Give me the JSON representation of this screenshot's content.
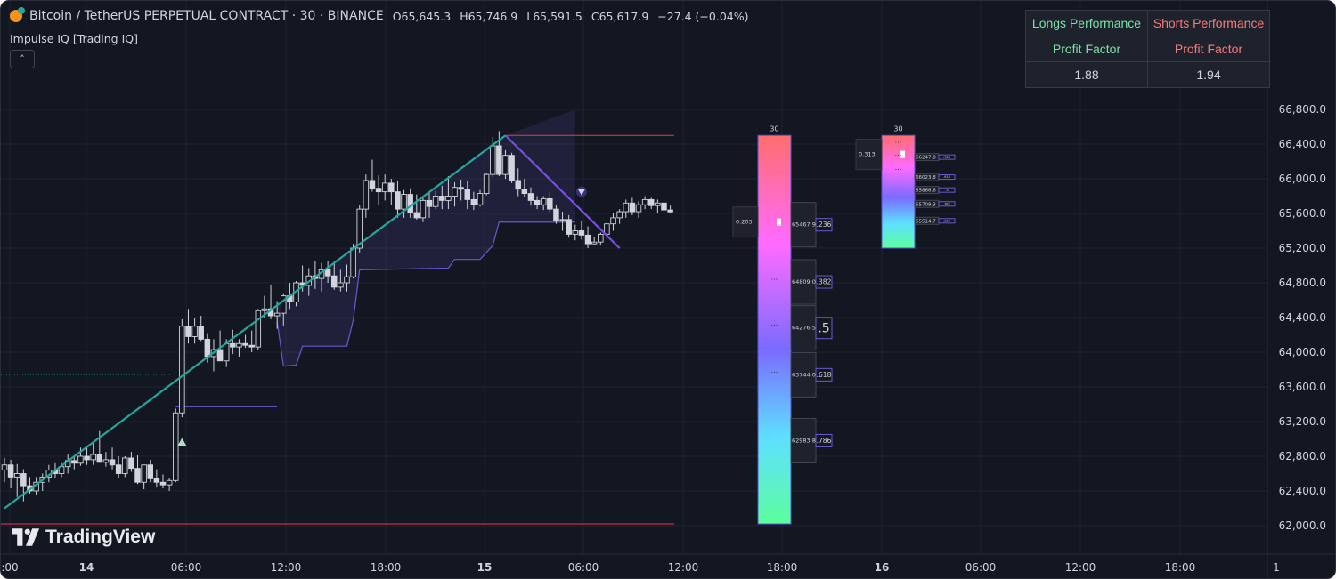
{
  "header": {
    "symbol": "Bitcoin / TetherUS PERPETUAL CONTRACT · 30 · BINANCE",
    "open": "O65,645.3",
    "high": "H65,746.9",
    "low": "L65,591.5",
    "close": "C65,617.9",
    "change": "−27.4 (−0.04%)"
  },
  "indicator": {
    "name": "Impulse IQ [Trading IQ]",
    "collapse_icon": "chevron-up-icon"
  },
  "performance": {
    "longs_header": "Longs Performance",
    "shorts_header": "Shorts Performance",
    "longs_metric": "Profit Factor",
    "shorts_metric": "Profit Factor",
    "longs_value": "1.88",
    "shorts_value": "1.94"
  },
  "branding": {
    "logo_text": "TradingView",
    "logo_icon": "tradingview-logo-icon"
  },
  "colors": {
    "background": "#131722",
    "grid": "#1f2330",
    "text": "#d1d4dc",
    "up_trend": "#26a69a",
    "down_trend": "#7b4fe0",
    "level_red": "#f23645",
    "zone_fill": "#6a5acd",
    "long_header": "#7ee0a6",
    "short_header": "#f77b7b"
  },
  "chart_data": {
    "type": "candlestick",
    "timeframe": "30",
    "ylim": [
      61900,
      66900
    ],
    "y_ticks": [
      "66,800.0",
      "66,400.0",
      "66,000.0",
      "65,600.0",
      "65,200.0",
      "64,800.0",
      "64,400.0",
      "64,000.0",
      "63,600.0",
      "63,200.0",
      "62,800.0",
      "62,400.0",
      "62,000.0"
    ],
    "x_ticks": [
      ":00",
      "14",
      "06:00",
      "12:00",
      "18:00",
      "15",
      "06:00",
      "12:00",
      "18:00",
      "16",
      "06:00",
      "12:00",
      "18:00",
      "1"
    ],
    "candles_ohlc": [
      [
        62640,
        62780,
        62500,
        62700
      ],
      [
        62700,
        62760,
        62430,
        62560
      ],
      [
        62560,
        62710,
        62330,
        62600
      ],
      [
        62600,
        62650,
        62280,
        62460
      ],
      [
        62460,
        62560,
        62370,
        62400
      ],
      [
        62400,
        62560,
        62350,
        62500
      ],
      [
        62500,
        62600,
        62400,
        62560
      ],
      [
        62560,
        62700,
        62500,
        62640
      ],
      [
        62640,
        62720,
        62550,
        62600
      ],
      [
        62600,
        62720,
        62560,
        62680
      ],
      [
        62680,
        62820,
        62600,
        62750
      ],
      [
        62750,
        62800,
        62650,
        62720
      ],
      [
        62720,
        62900,
        62690,
        62800
      ],
      [
        62800,
        62900,
        62700,
        62760
      ],
      [
        62760,
        62960,
        62700,
        62820
      ],
      [
        62820,
        63090,
        62750,
        62730
      ],
      [
        62730,
        62850,
        62680,
        62760
      ],
      [
        62760,
        62900,
        62650,
        62700
      ],
      [
        62700,
        62800,
        62550,
        62600
      ],
      [
        62600,
        62800,
        62560,
        62780
      ],
      [
        62780,
        62850,
        62620,
        62660
      ],
      [
        62660,
        62810,
        62480,
        62500
      ],
      [
        62500,
        62700,
        62420,
        62700
      ],
      [
        62700,
        62760,
        62500,
        62540
      ],
      [
        62540,
        62650,
        62440,
        62500
      ],
      [
        62500,
        62590,
        62430,
        62470
      ],
      [
        62470,
        62550,
        62400,
        62520
      ],
      [
        62520,
        63350,
        62500,
        63300
      ],
      [
        63300,
        64380,
        63250,
        64300
      ],
      [
        64300,
        64500,
        64100,
        64180
      ],
      [
        64180,
        64400,
        64100,
        64300
      ],
      [
        64300,
        64420,
        64130,
        64150
      ],
      [
        64150,
        64220,
        63880,
        63950
      ],
      [
        63950,
        64150,
        63780,
        64030
      ],
      [
        64030,
        64250,
        63900,
        63900
      ],
      [
        63900,
        64150,
        63830,
        64100
      ],
      [
        64100,
        64260,
        63980,
        64060
      ],
      [
        64060,
        64150,
        63950,
        64100
      ],
      [
        64100,
        64200,
        64050,
        64080
      ],
      [
        64080,
        64250,
        64000,
        64060
      ],
      [
        64060,
        64500,
        64030,
        64480
      ],
      [
        64480,
        64650,
        64400,
        64500
      ],
      [
        64500,
        64780,
        64380,
        64420
      ],
      [
        64420,
        64590,
        64270,
        64450
      ],
      [
        64450,
        64680,
        64300,
        64650
      ],
      [
        64650,
        64800,
        64500,
        64580
      ],
      [
        64580,
        64820,
        64530,
        64800
      ],
      [
        64800,
        65000,
        64700,
        64770
      ],
      [
        64770,
        64970,
        64650,
        64880
      ],
      [
        64880,
        65050,
        64730,
        64850
      ],
      [
        64850,
        65030,
        64700,
        64950
      ],
      [
        64950,
        65050,
        64800,
        64880
      ],
      [
        64880,
        65040,
        64720,
        64750
      ],
      [
        64750,
        64950,
        64700,
        64800
      ],
      [
        64800,
        65010,
        64700,
        64870
      ],
      [
        64870,
        65250,
        64850,
        65200
      ],
      [
        65200,
        65700,
        65150,
        65650
      ],
      [
        65650,
        66050,
        65550,
        65980
      ],
      [
        65980,
        66220,
        65850,
        65890
      ],
      [
        65890,
        66040,
        65700,
        65850
      ],
      [
        65850,
        66050,
        65750,
        65950
      ],
      [
        65950,
        66000,
        65700,
        65850
      ],
      [
        65850,
        65980,
        65550,
        65650
      ],
      [
        65650,
        65870,
        65550,
        65820
      ],
      [
        65820,
        65890,
        65550,
        65610
      ],
      [
        65610,
        65820,
        65530,
        65550
      ],
      [
        65550,
        65780,
        65500,
        65750
      ],
      [
        65750,
        65850,
        65550,
        65680
      ],
      [
        65680,
        65860,
        65650,
        65800
      ],
      [
        65800,
        65920,
        65650,
        65750
      ],
      [
        65750,
        66030,
        65650,
        65800
      ],
      [
        65800,
        65960,
        65680,
        65900
      ],
      [
        65900,
        65990,
        65750,
        65880
      ],
      [
        65880,
        65980,
        65650,
        65760
      ],
      [
        65760,
        65850,
        65640,
        65700
      ],
      [
        65700,
        65870,
        65680,
        65830
      ],
      [
        65830,
        66070,
        65810,
        66050
      ],
      [
        66050,
        66480,
        66020,
        66380
      ],
      [
        66380,
        66550,
        66030,
        66050
      ],
      [
        66050,
        66330,
        66000,
        66270
      ],
      [
        66270,
        66300,
        65950,
        65980
      ],
      [
        65980,
        66120,
        65800,
        65880
      ],
      [
        65880,
        66000,
        65790,
        65830
      ],
      [
        65830,
        65900,
        65690,
        65750
      ],
      [
        65750,
        65800,
        65650,
        65700
      ],
      [
        65700,
        65800,
        65640,
        65770
      ],
      [
        65770,
        65850,
        65600,
        65650
      ],
      [
        65650,
        65700,
        65480,
        65520
      ],
      [
        65520,
        65620,
        65400,
        65530
      ],
      [
        65530,
        65580,
        65320,
        65360
      ],
      [
        65360,
        65470,
        65290,
        65400
      ],
      [
        65400,
        65510,
        65300,
        65350
      ],
      [
        65350,
        65450,
        65200,
        65250
      ],
      [
        65250,
        65330,
        65240,
        65270
      ],
      [
        65270,
        65380,
        65230,
        65360
      ],
      [
        65360,
        65500,
        65300,
        65480
      ],
      [
        65480,
        65600,
        65400,
        65550
      ],
      [
        65550,
        65650,
        65480,
        65620
      ],
      [
        65620,
        65760,
        65550,
        65720
      ],
      [
        65720,
        65780,
        65580,
        65620
      ],
      [
        65620,
        65740,
        65550,
        65700
      ],
      [
        65700,
        65800,
        65650,
        65760
      ],
      [
        65760,
        65780,
        65650,
        65690
      ],
      [
        65690,
        65760,
        65610,
        65720
      ],
      [
        65720,
        65730,
        65600,
        65640
      ],
      [
        65640,
        65690,
        65600,
        65618
      ]
    ],
    "impulse_lines": [
      {
        "type": "up",
        "from": [
          62200,
          0
        ],
        "to": [
          66500,
          79
        ]
      },
      {
        "type": "down",
        "from": [
          66500,
          79
        ],
        "to": [
          65200,
          97
        ]
      }
    ],
    "horizontal_levels": [
      {
        "color": "red",
        "price": 66500
      },
      {
        "color": "red",
        "price": 62020
      },
      {
        "color": "purple",
        "price": 63370
      },
      {
        "color": "purple",
        "price": 65500
      }
    ],
    "trailing_zone": [
      [
        64360,
        43
      ],
      [
        63840,
        44
      ],
      [
        63850,
        46
      ],
      [
        64070,
        47
      ],
      [
        64070,
        54
      ],
      [
        64370,
        55
      ],
      [
        64950,
        56
      ],
      [
        64970,
        70
      ],
      [
        65070,
        71
      ],
      [
        65070,
        75
      ],
      [
        65230,
        77
      ],
      [
        65500,
        78
      ],
      [
        65500,
        90
      ]
    ],
    "signals": [
      {
        "type": "long",
        "price": 62960,
        "bar": 28
      },
      {
        "type": "short",
        "price": 65850,
        "bar": 91
      }
    ],
    "fib_profile_1": {
      "header": "30",
      "top": 66500,
      "bottom": 62020,
      "side_label": "0.203",
      "levels": [
        {
          "price_label": "65467.9",
          "ratio_label": ".236",
          "price": 65470
        },
        {
          "price_label": "64809.0",
          "ratio_label": ".382",
          "price": 64810
        },
        {
          "price_label": "64276.5",
          "ratio_label": ".5",
          "price": 64280
        },
        {
          "price_label": "63744.0",
          "ratio_label": ".618",
          "price": 63740
        },
        {
          "price_label": "62983.8",
          "ratio_label": ".786",
          "price": 62980
        }
      ]
    },
    "fib_profile_2": {
      "header": "30",
      "top": 66500,
      "bottom": 65200,
      "side_label": "0.313",
      "levels": [
        {
          "price_label": "66247.8",
          "ratio_label": ".786",
          "price": 66250
        },
        {
          "price_label": "66023.8",
          "ratio_label": ".618",
          "price": 66020
        },
        {
          "price_label": "65866.6",
          "ratio_label": ".5",
          "price": 65870
        },
        {
          "price_label": "65709.3",
          "ratio_label": ".382",
          "price": 65710
        },
        {
          "price_label": "65514.7",
          "ratio_label": ".236",
          "price": 65515
        }
      ]
    }
  }
}
